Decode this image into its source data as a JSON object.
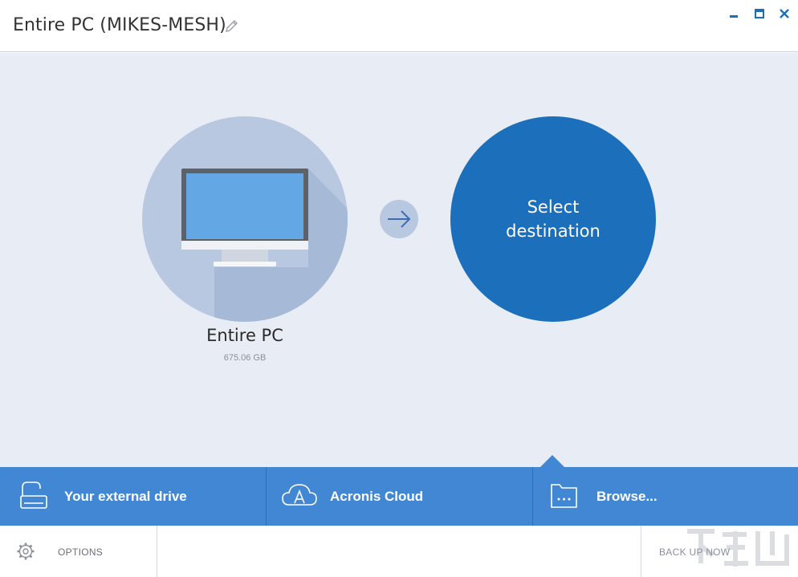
{
  "header": {
    "title": "Entire PC (MIKES-MESH)"
  },
  "source": {
    "label": "Entire PC",
    "size": "675.06 GB",
    "icon": "monitor-icon"
  },
  "destination": {
    "label": "Select destination"
  },
  "destination_options": [
    {
      "label": "Your external drive",
      "icon": "external-drive-icon"
    },
    {
      "label": "Acronis Cloud",
      "icon": "cloud-icon"
    },
    {
      "label": "Browse...",
      "icon": "folder-icon"
    }
  ],
  "footer": {
    "options_label": "OPTIONS",
    "backup_label": "BACK UP NOW"
  },
  "colors": {
    "accent": "#1c6fba",
    "bar": "#4287d4",
    "background": "#e8ecf4",
    "circle_light": "#b8c8e0"
  }
}
